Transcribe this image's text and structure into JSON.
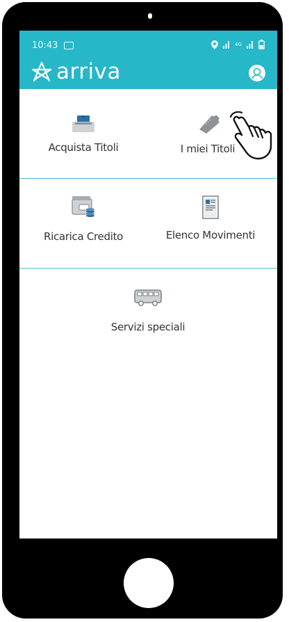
{
  "status_bar": {
    "time": "10:43",
    "network": "4G",
    "icons": [
      "message-icon",
      "location-icon",
      "signal-icon",
      "signal-icon",
      "battery-icon"
    ]
  },
  "header": {
    "brand": "arriva",
    "color": "#26b7c8",
    "profile_icon": "user-icon"
  },
  "menu": {
    "acquista": {
      "label": "Acquista Titoli",
      "icon": "ticket-machine-icon"
    },
    "miei": {
      "label": "I miei Titoli",
      "icon": "ticket-icon"
    },
    "ricarica": {
      "label": "Ricarica Credito",
      "icon": "wallet-icon"
    },
    "elenco": {
      "label": "Elenco Movimenti",
      "icon": "document-icon"
    },
    "servizi": {
      "label": "Servizi speciali",
      "icon": "bus-icon"
    }
  },
  "colors": {
    "divider": "#4cc6d1",
    "label": "#333333"
  }
}
